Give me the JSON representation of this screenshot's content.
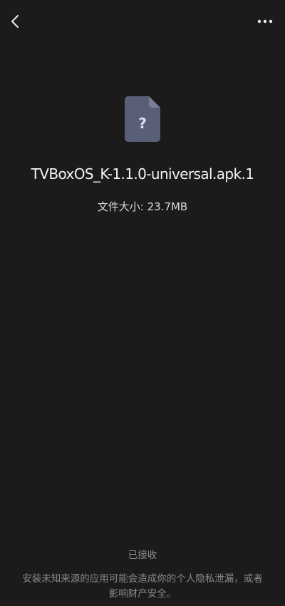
{
  "header": {
    "back_icon": "chevron-left-icon",
    "more_icon": "more-horizontal-icon"
  },
  "file": {
    "icon": "unknown-file-icon",
    "icon_glyph": "?",
    "name": "TVBoxOS_K-1.1.0-universal.apk.1",
    "size_text": "文件大小: 23.7MB"
  },
  "footer": {
    "status": "已接收",
    "warning": "安装未知来源的应用可能会造成你的个人隐私泄漏，或者影响财产安全。"
  },
  "colors": {
    "background": "#1b1b1b",
    "file_icon": "#5a5f78",
    "file_icon_fold": "#7a7f99"
  }
}
